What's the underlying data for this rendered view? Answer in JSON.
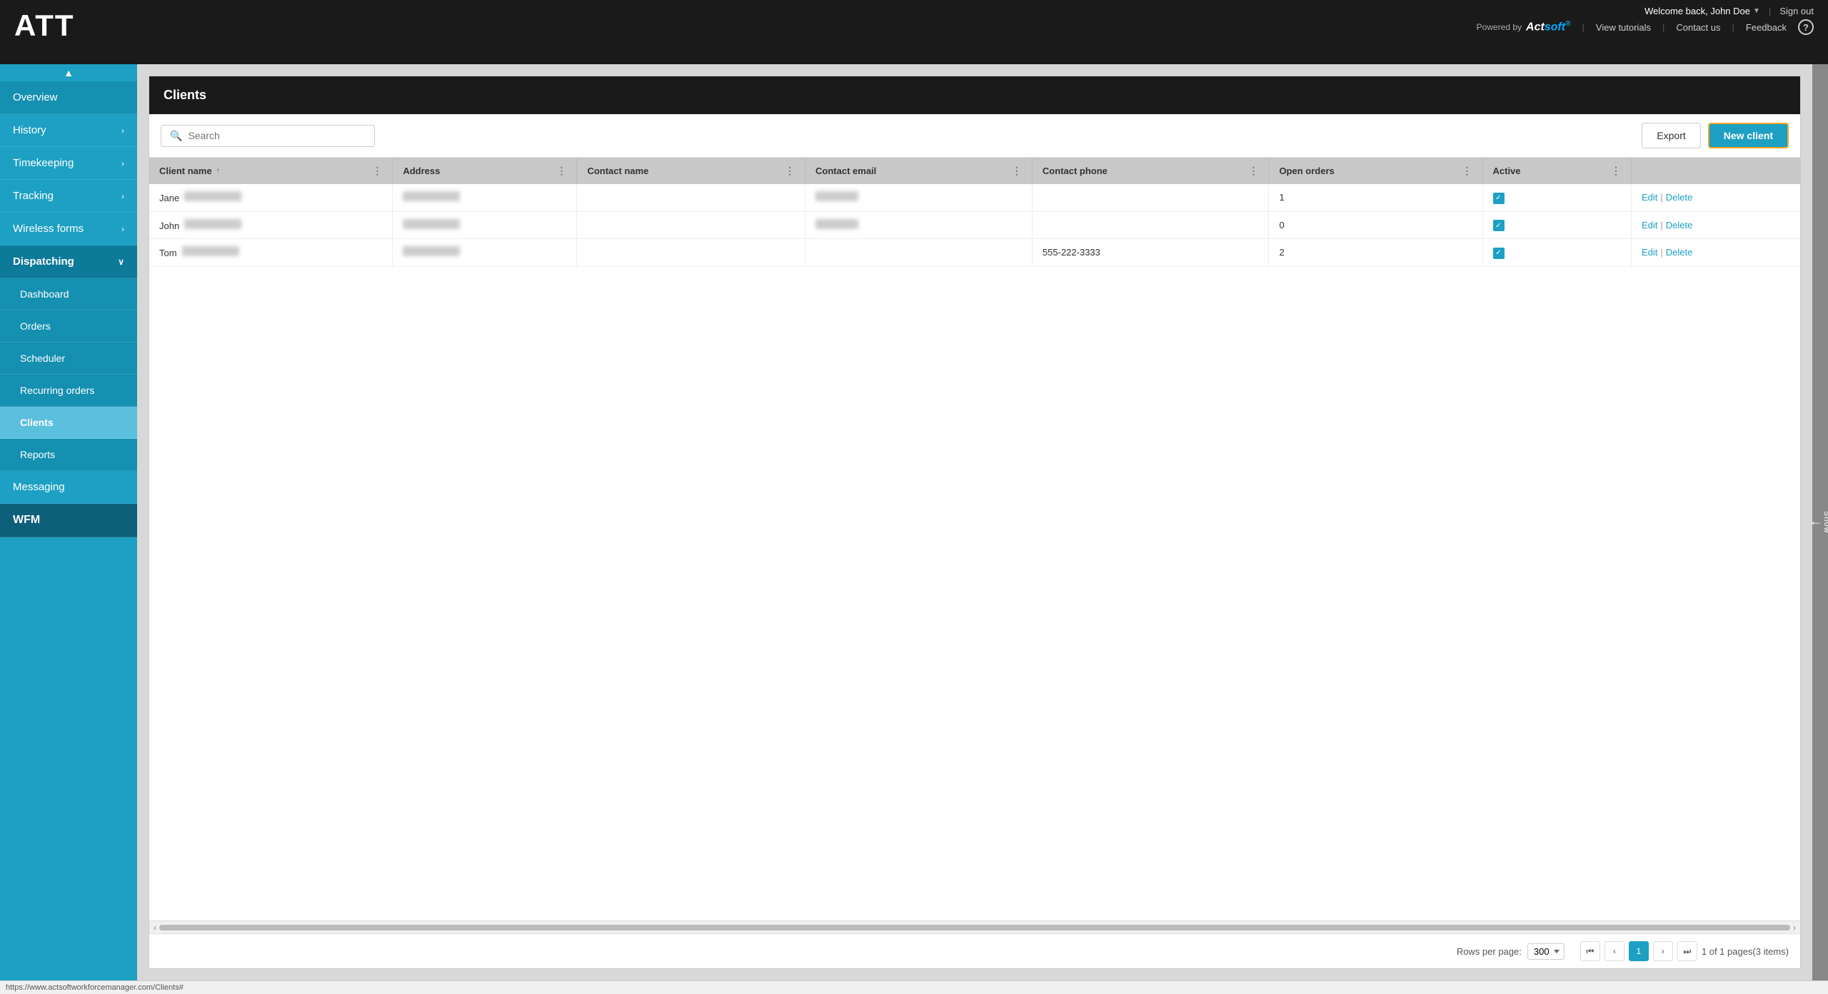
{
  "app": {
    "logo": "ATT",
    "powered_by": "Powered by",
    "actsoft_brand": "Actsoft",
    "welcome_text": "Welcome back, John Doe",
    "sign_out_label": "Sign out",
    "view_tutorials_label": "View tutorials",
    "contact_us_label": "Contact us",
    "feedback_label": "Feedback"
  },
  "sidebar": {
    "scroll_up_icon": "▲",
    "items": [
      {
        "id": "overview",
        "label": "Overview",
        "has_arrow": false,
        "type": "top"
      },
      {
        "id": "history",
        "label": "History",
        "has_arrow": true,
        "type": "top"
      },
      {
        "id": "timekeeping",
        "label": "Timekeeping",
        "has_arrow": true,
        "type": "top"
      },
      {
        "id": "tracking",
        "label": "Tracking",
        "has_arrow": true,
        "type": "top"
      },
      {
        "id": "wireless-forms",
        "label": "Wireless forms",
        "has_arrow": true,
        "type": "top"
      },
      {
        "id": "dispatching",
        "label": "Dispatching",
        "has_arrow": true,
        "type": "section",
        "expanded": true
      },
      {
        "id": "dashboard",
        "label": "Dashboard",
        "has_arrow": false,
        "type": "sub"
      },
      {
        "id": "orders",
        "label": "Orders",
        "has_arrow": false,
        "type": "sub"
      },
      {
        "id": "scheduler",
        "label": "Scheduler",
        "has_arrow": false,
        "type": "sub"
      },
      {
        "id": "recurring-orders",
        "label": "Recurring orders",
        "has_arrow": false,
        "type": "sub"
      },
      {
        "id": "clients",
        "label": "Clients",
        "has_arrow": false,
        "type": "sub",
        "active": true
      },
      {
        "id": "reports",
        "label": "Reports",
        "has_arrow": false,
        "type": "sub"
      },
      {
        "id": "messaging",
        "label": "Messaging",
        "has_arrow": false,
        "type": "top"
      },
      {
        "id": "wfm",
        "label": "WFM",
        "has_arrow": false,
        "type": "wfm"
      }
    ]
  },
  "show_panel": {
    "arrow": "←",
    "label": "Show"
  },
  "clients_page": {
    "title": "Clients",
    "search_placeholder": "Search",
    "export_label": "Export",
    "new_client_label": "New client",
    "columns": [
      {
        "id": "client-name",
        "label": "Client name",
        "sort": "↑",
        "menu": true
      },
      {
        "id": "address",
        "label": "Address",
        "sort": "",
        "menu": true
      },
      {
        "id": "contact-name",
        "label": "Contact name",
        "sort": "",
        "menu": true
      },
      {
        "id": "contact-email",
        "label": "Contact email",
        "sort": "",
        "menu": true
      },
      {
        "id": "contact-phone",
        "label": "Contact phone",
        "sort": "",
        "menu": true
      },
      {
        "id": "open-orders",
        "label": "Open orders",
        "sort": "",
        "menu": true
      },
      {
        "id": "active",
        "label": "Active",
        "sort": "",
        "menu": true
      },
      {
        "id": "actions",
        "label": "",
        "sort": "",
        "menu": false
      }
    ],
    "rows": [
      {
        "id": "jane",
        "client_name": "Jane",
        "address_blurred": true,
        "contact_name_blurred": false,
        "contact_email_blurred": true,
        "contact_phone": "",
        "open_orders": "1",
        "active": true,
        "edit_label": "Edit",
        "delete_label": "Delete"
      },
      {
        "id": "john",
        "client_name": "John",
        "address_blurred": true,
        "contact_name_blurred": false,
        "contact_email_blurred": true,
        "contact_phone": "",
        "open_orders": "0",
        "active": true,
        "edit_label": "Edit",
        "delete_label": "Delete"
      },
      {
        "id": "tom",
        "client_name": "Tom",
        "address_blurred": true,
        "contact_name_blurred": false,
        "contact_email_blurred": false,
        "contact_phone": "555-222-3333",
        "open_orders": "2",
        "active": true,
        "edit_label": "Edit",
        "delete_label": "Delete"
      }
    ],
    "pagination": {
      "current_page": "1",
      "rows_per_page_label": "Rows per page:",
      "rows_per_page_value": "300",
      "page_info": "1 of 1 pages(3 items)",
      "first_label": "⏮",
      "prev_label": "‹",
      "next_label": "›",
      "last_label": "⏭"
    }
  },
  "status_bar": {
    "url": "https://www.actsoftworkforcemanager.com/Clients#"
  }
}
